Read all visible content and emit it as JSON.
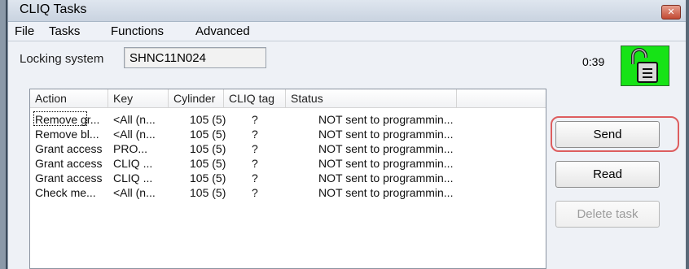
{
  "window": {
    "title": "CLIQ Tasks",
    "close_glyph": "✕"
  },
  "menu": [
    "File",
    "Tasks",
    "Functions",
    "Advanced"
  ],
  "locking_system": {
    "label": "Locking system",
    "value": "SHNC11N024"
  },
  "timer": "0:39",
  "status_icon": "open-padlock-icon",
  "status_color": "#16e316",
  "table": {
    "headers": [
      "Action",
      "Key",
      "Cylinder",
      "CLIQ tag",
      "Status"
    ],
    "rows": [
      [
        "Remove gr...",
        "<All (n...",
        "105 (5)",
        "?",
        "NOT sent to programmin..."
      ],
      [
        "Remove bl...",
        "<All (n...",
        "105 (5)",
        "?",
        "NOT sent to programmin..."
      ],
      [
        "Grant access",
        "PRO...",
        "105 (5)",
        "?",
        "NOT sent to programmin..."
      ],
      [
        "Grant access",
        "CLIQ ...",
        "105 (5)",
        "?",
        "NOT sent to programmin..."
      ],
      [
        "Grant access",
        "CLIQ ...",
        "105 (5)",
        "?",
        "NOT sent to programmin..."
      ],
      [
        "Check me...",
        "<All (n...",
        "105 (5)",
        "?",
        "NOT sent to programmin..."
      ]
    ]
  },
  "buttons": {
    "send": "Send",
    "read": "Read",
    "delete": "Delete task"
  },
  "highlight_color": "#d83a3a"
}
